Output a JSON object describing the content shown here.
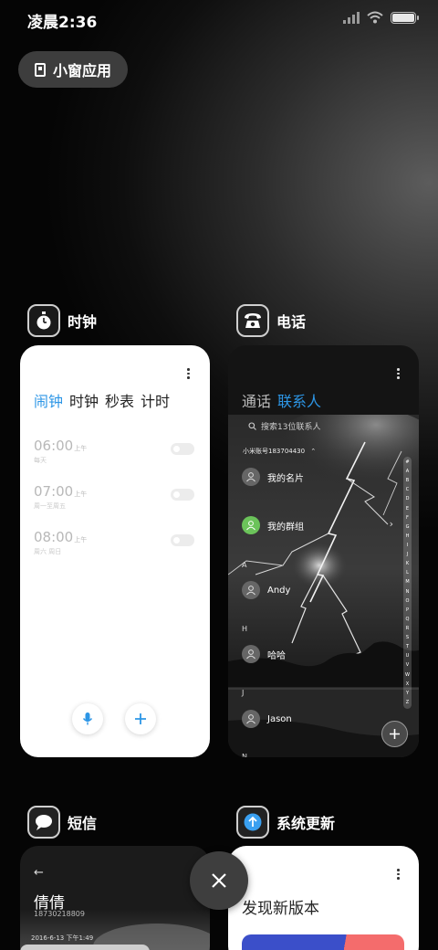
{
  "status_bar": {
    "time": "凌晨2:36"
  },
  "floating_window_button": {
    "label": "小窗应用"
  },
  "apps": {
    "clock": {
      "name": "时钟",
      "tabs": [
        "闹钟",
        "时钟",
        "秒表",
        "计时"
      ],
      "active_tab": "闹钟",
      "alarms": [
        {
          "time": "06:00",
          "period": "上午",
          "repeat": "每天",
          "enabled": false
        },
        {
          "time": "07:00",
          "period": "上午",
          "repeat": "周一至周五",
          "enabled": false
        },
        {
          "time": "08:00",
          "period": "上午",
          "repeat": "周六 周日",
          "enabled": false
        }
      ]
    },
    "contacts": {
      "name": "电话",
      "tabs": [
        "通话",
        "联系人"
      ],
      "active_tab": "联系人",
      "search_placeholder": "搜索13位联系人",
      "account": "小米账号183704430",
      "rows": [
        {
          "type": "contact",
          "name": "我的名片"
        },
        {
          "type": "contact",
          "name": "我的群组"
        },
        {
          "type": "letter",
          "name": "A"
        },
        {
          "type": "contact",
          "name": "Andy"
        },
        {
          "type": "letter",
          "name": "H"
        },
        {
          "type": "contact",
          "name": "哈哈"
        },
        {
          "type": "letter",
          "name": "J"
        },
        {
          "type": "contact",
          "name": "Jason"
        },
        {
          "type": "letter",
          "name": "N"
        }
      ],
      "index_letters": [
        "#",
        "A",
        "B",
        "C",
        "D",
        "E",
        "F",
        "G",
        "H",
        "I",
        "J",
        "K",
        "L",
        "M",
        "N",
        "O",
        "P",
        "Q",
        "R",
        "S",
        "T",
        "U",
        "V",
        "W",
        "X",
        "Y",
        "Z"
      ]
    },
    "sms": {
      "name": "短信",
      "contact_name": "倩倩",
      "phone": "18730218809",
      "date": "2016-6-13 下午1:49"
    },
    "updater": {
      "name": "系统更新",
      "headline": "发现新版本"
    }
  },
  "colors": {
    "accent": "#2d96e6",
    "green_avatar": "#6bc35a",
    "update_banner_left": "#3b4fc9",
    "update_banner_right": "#f46c6c"
  }
}
